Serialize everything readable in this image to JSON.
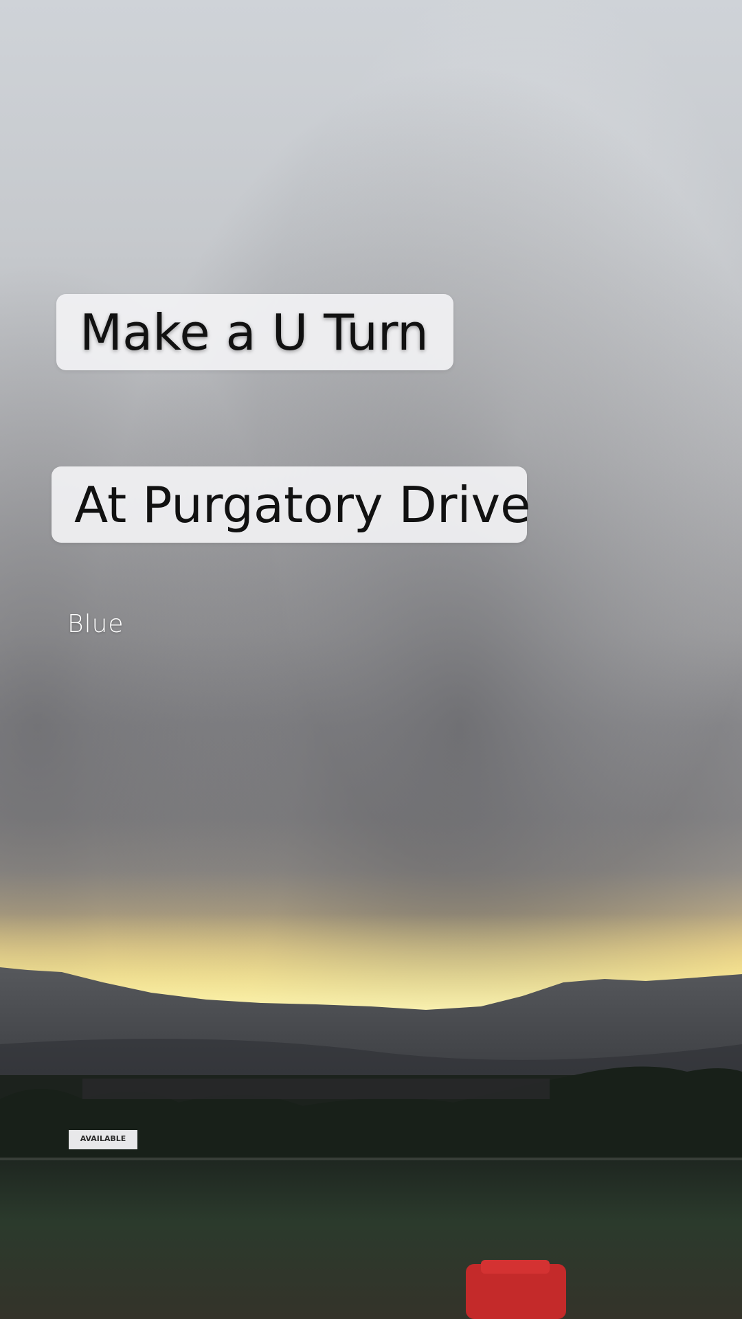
{
  "overlay": {
    "caption_1": "Make a U Turn",
    "caption_2": "At Purgatory Drive",
    "tag": "Blue"
  },
  "scene": {
    "sign_text": "AVAILABLE",
    "colors": {
      "sky_top": "#d4d7db",
      "sky_mid": "#a9a9ab",
      "storm_band": "#6e6e72",
      "sunset_glow": "#ffd84a",
      "mountains": "#3f4145",
      "ground": "#1f2a1f",
      "red_object": "#c42a2a"
    }
  }
}
